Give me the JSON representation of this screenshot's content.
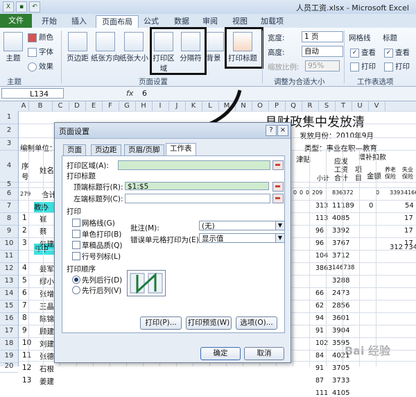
{
  "window": {
    "title": "人员工资.xlsx - Microsoft Excel"
  },
  "tabs": [
    "文件",
    "开始",
    "插入",
    "页面布局",
    "公式",
    "数据",
    "审阅",
    "视图",
    "加载项"
  ],
  "ribbon": {
    "theme_group": {
      "label": "主题",
      "main": "主题",
      "colors": "颜色",
      "fonts": "字体",
      "effects": "效果"
    },
    "page_setup_group": {
      "label": "页面设置",
      "margins": "页边距",
      "orientation": "纸张方向",
      "size": "纸张大小",
      "print_area": "打印区域",
      "breaks": "分隔符",
      "background": "背景",
      "print_titles": "打印标题"
    },
    "scale_group": {
      "label": "调整为合适大小",
      "width_label": "宽度:",
      "width_value": "1 页",
      "height_label": "高度:",
      "height_value": "自动",
      "scale_label": "缩放比例:",
      "scale_value": "95%"
    },
    "sheet_options_group": {
      "label": "工作表选项",
      "gridlines": "网格线",
      "headings": "标题",
      "view1": "查看",
      "print1": "打印",
      "view2": "查看",
      "print2": "打印"
    }
  },
  "formula_bar": {
    "name_box": "L134",
    "fx": "fx",
    "value": "6"
  },
  "columns": [
    "A",
    "B",
    "C",
    "D",
    "E",
    "F",
    "G",
    "H",
    "I",
    "J",
    "K",
    "L",
    "M",
    "N",
    "O",
    "P",
    "Q",
    "R",
    "S",
    "T",
    "U",
    "V"
  ],
  "rows": [
    "1",
    "2",
    "3",
    "4",
    "5",
    "6",
    "7",
    "8",
    "9",
    "10",
    "11",
    "12",
    "13",
    "14",
    "15",
    "16",
    "17",
    "18",
    "19",
    "20",
    "21"
  ],
  "sheet": {
    "title_fragment": "县财政集中发放清",
    "date_label": "发放月份：2010年9月",
    "category_label": "类型：事业在职—教育",
    "unit_label": "编制单位：",
    "header_seq": "序号",
    "header_name": "姓名",
    "header_subsidy": "津贴",
    "header_subtotal": "小计",
    "header_payable": "应发工资合计",
    "header_deduct": "增补扣款",
    "header_item": "项目",
    "header_amount": "金额",
    "header_pension": "养老保险",
    "header_unemp": "失业保险",
    "total_label": "合计",
    "row6_a": "279",
    "row6_vals": [
      "0",
      "0",
      "0",
      "209",
      "836372",
      "0",
      "3393",
      "4166"
    ],
    "cyan_row7": "教办",
    "cyan_row11": "斗中",
    "names": [
      "崔",
      "蔡",
      "朱建",
      "",
      "姜军",
      "缪小",
      "张增",
      "王晶",
      "陈锦",
      "顾建",
      "刘建",
      "张德",
      "石根",
      "姜建"
    ],
    "seqs": [
      "1",
      "2",
      "3",
      "",
      "4",
      "5",
      "6",
      "7",
      "8",
      "9",
      "10",
      "11",
      "12",
      "13"
    ],
    "subtotals": [
      "313",
      "113",
      "96",
      "96",
      "104",
      "3863",
      "",
      "66",
      "62",
      "94",
      "91",
      "102",
      "84",
      "91",
      "87",
      "111"
    ],
    "payables": [
      "11189",
      "4085",
      "3392",
      "3767",
      "3712",
      "146738",
      "3288",
      "2473",
      "2856",
      "3601",
      "3904",
      "3595",
      "4021",
      "3705",
      "3733",
      "4105"
    ],
    "tail_vals": [
      "0",
      "54",
      "17",
      "17",
      "17",
      "312",
      "734"
    ]
  },
  "dialog": {
    "title": "页面设置",
    "tabs": [
      "页面",
      "页边距",
      "页眉/页脚",
      "工作表"
    ],
    "print_area_label": "打印区域(A):",
    "print_titles_label": "打印标题",
    "top_rows_label": "顶端标题行(R):",
    "top_rows_value": "$1:$5",
    "left_cols_label": "左端标题列(C):",
    "print_section": "打印",
    "gridlines": "网格线(G)",
    "mono": "单色打印(B)",
    "draft": "草稿品质(Q)",
    "row_col_headings": "行号列标(L)",
    "comments_label": "批注(M):",
    "comments_value": "(无)",
    "errors_label": "错误单元格打印为(E):",
    "errors_value": "显示值",
    "order_section": "打印顺序",
    "down_then_over": "先列后行(D)",
    "over_then_down": "先行后列(V)",
    "btn_print": "打印(P)...",
    "btn_preview": "打印预览(W)",
    "btn_options": "选项(O)...",
    "btn_ok": "确定",
    "btn_cancel": "取消"
  },
  "watermark": "Bai 经验"
}
